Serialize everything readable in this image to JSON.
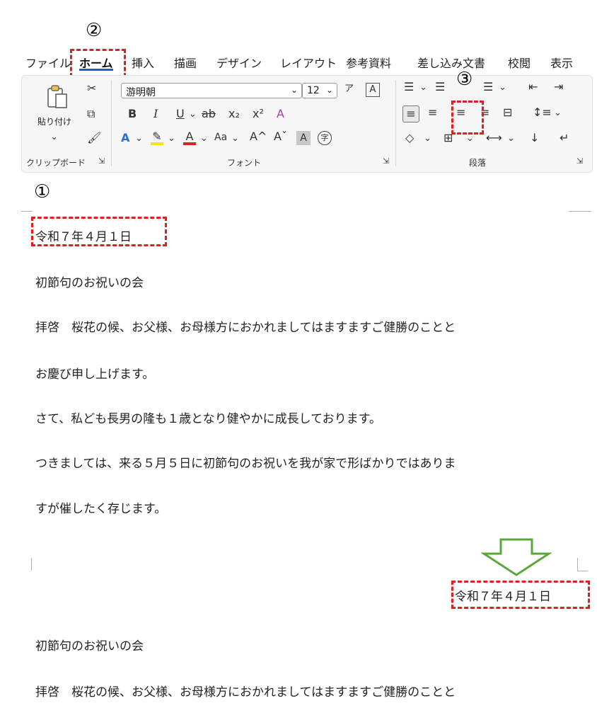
{
  "markers": {
    "one": "①",
    "two": "②",
    "three": "③"
  },
  "tabs": [
    "ファイル",
    "ホーム",
    "挿入",
    "描画",
    "デザイン",
    "レイアウト",
    "参考資料",
    "差し込み文書",
    "校閲",
    "表示"
  ],
  "ribbon": {
    "clipboard": {
      "paste_label": "貼り付け",
      "group_label": "クリップボード"
    },
    "font": {
      "font_name": "游明朝",
      "font_size": "12",
      "bold": "B",
      "italic": "I",
      "underline": "U",
      "strike": "ab",
      "subscript": "x₂",
      "superscript": "x²",
      "font_color_letter": "A",
      "highlight_letter": "A",
      "case_label": "Aa",
      "grow_font": "A^",
      "shrink_font": "Aˇ",
      "char_shading": "A",
      "enclose_char": "字",
      "group_label": "フォント"
    },
    "paragraph": {
      "group_label": "段落"
    }
  },
  "document_before": {
    "date": "令和７年４月１日",
    "title": "初節句のお祝いの会",
    "lines": [
      "拝啓　桜花の候、お父様、お母様方におかれましてはますますご健勝のことと",
      "お慶び申し上げます。",
      "さて、私ども長男の隆も１歳となり健やかに成長しております。",
      "つきましては、来る５月５日に初節句のお祝いを我が家で形ばかりではありま",
      "すが催したく存じます。"
    ]
  },
  "document_after": {
    "date": "令和７年４月１日",
    "title": "初節句のお祝いの会",
    "line1": "拝啓　桜花の候、お父様、お母様方におかれましてはますますご健勝のことと"
  },
  "colors": {
    "annotation": "#e02020",
    "arrow": "#5aa83a",
    "accent": "#1f5fbf"
  }
}
